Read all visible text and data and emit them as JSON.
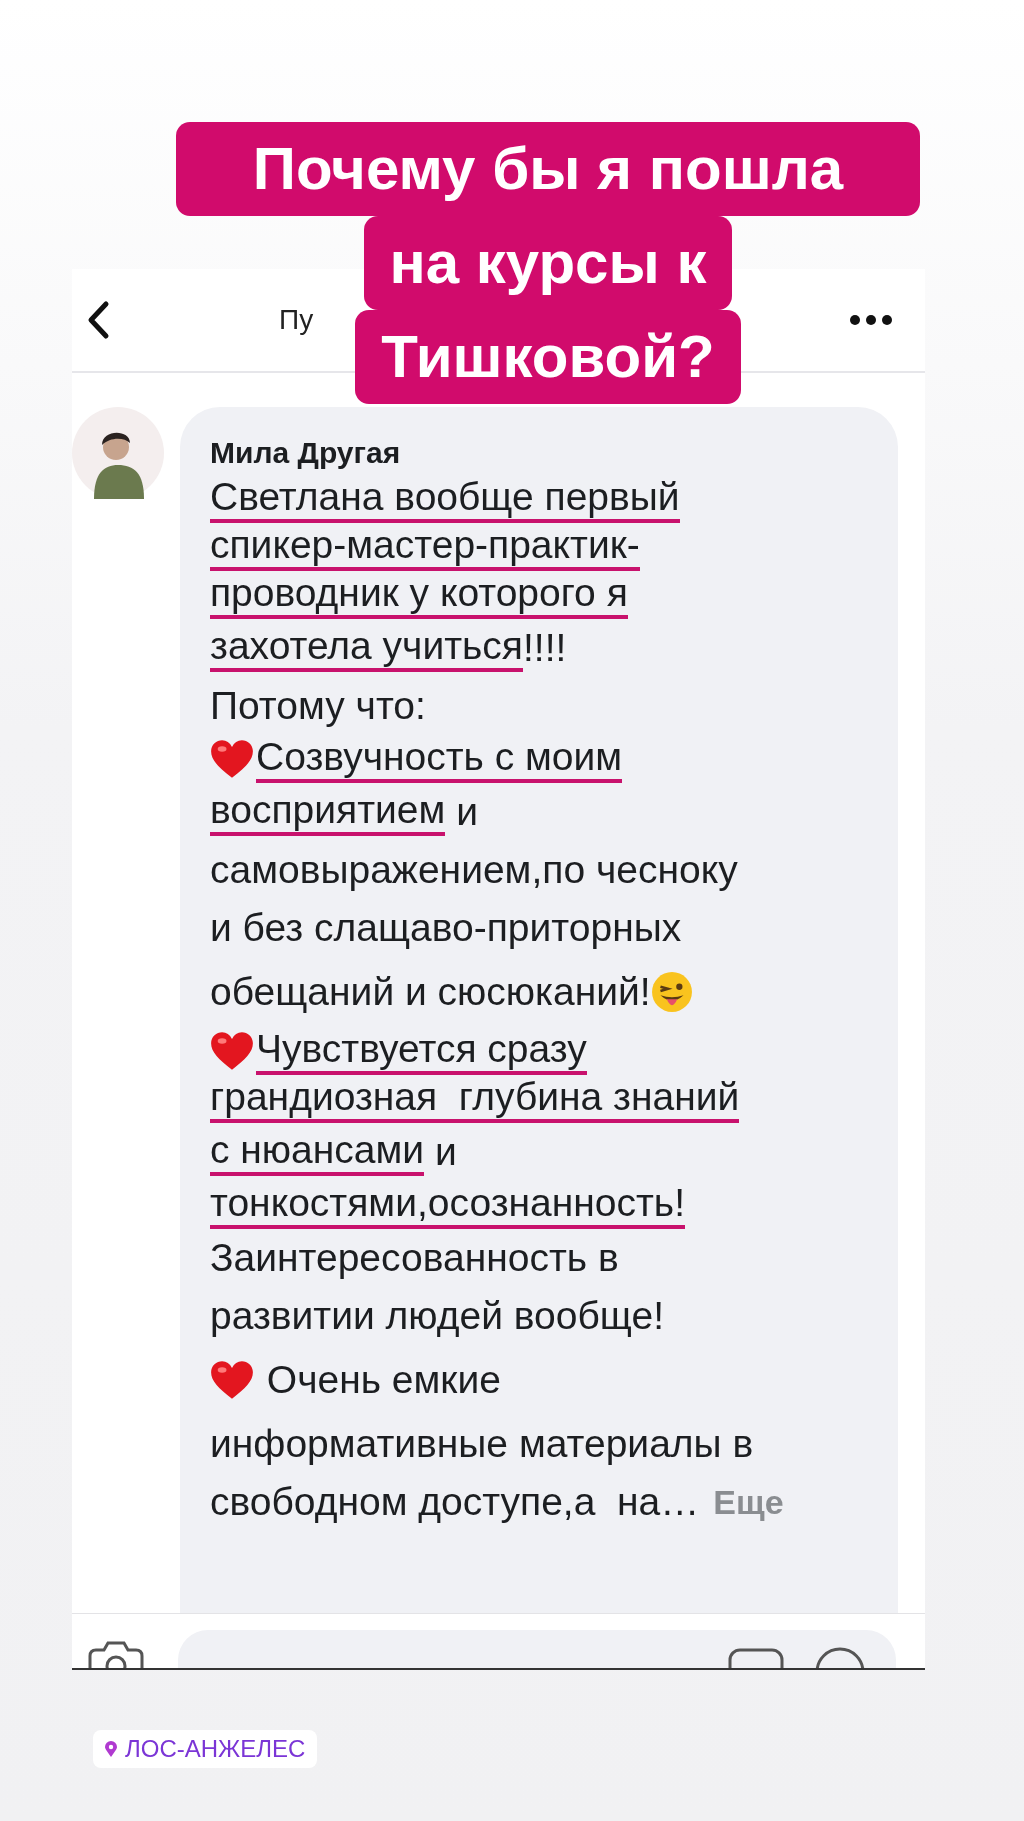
{
  "sticker": {
    "lines": [
      "Почему бы я пошла",
      "на курсы к",
      "Тишковой?"
    ]
  },
  "header": {
    "title": "Пу"
  },
  "comment": {
    "author": "Мила Другая",
    "more": "Еще",
    "lines": [
      {
        "parts": [
          {
            "kind": "text",
            "text": "Светлана вообще первый",
            "underlined": true
          }
        ]
      },
      {
        "parts": [
          {
            "kind": "text",
            "text": "спикер-мастер-практик-",
            "underlined": true
          }
        ]
      },
      {
        "parts": [
          {
            "kind": "text",
            "text": "проводник у которого я",
            "underlined": true
          }
        ]
      },
      {
        "parts": [
          {
            "kind": "text",
            "text": "захотела учиться",
            "underlined": true
          },
          {
            "kind": "text",
            "text": "!!!!",
            "underlined": false
          }
        ]
      },
      {
        "parts": [
          {
            "kind": "text",
            "text": "Потому что:",
            "underlined": false
          }
        ]
      },
      {
        "parts": [
          {
            "kind": "heart"
          },
          {
            "kind": "text",
            "text": "Созвучность с моим",
            "underlined": true
          }
        ]
      },
      {
        "parts": [
          {
            "kind": "text",
            "text": "восприятием",
            "underlined": true
          },
          {
            "kind": "text",
            "text": " и",
            "underlined": false
          }
        ]
      },
      {
        "parts": [
          {
            "kind": "text",
            "text": "самовыражением,по чесноку",
            "underlined": false
          }
        ]
      },
      {
        "parts": [
          {
            "kind": "text",
            "text": "и без слащаво-приторных",
            "underlined": false
          }
        ]
      },
      {
        "parts": [
          {
            "kind": "text",
            "text": "обещаний и сюсюканий!",
            "underlined": false
          },
          {
            "kind": "wink"
          }
        ]
      },
      {
        "parts": [
          {
            "kind": "heart"
          },
          {
            "kind": "text",
            "text": "Чувствуется сразу",
            "underlined": true
          }
        ]
      },
      {
        "parts": [
          {
            "kind": "text",
            "text": "грандиозная  глубина знаний",
            "underlined": true
          }
        ]
      },
      {
        "parts": [
          {
            "kind": "text",
            "text": "с нюансами",
            "underlined": true
          },
          {
            "kind": "text",
            "text": " и",
            "underlined": false
          }
        ]
      },
      {
        "parts": [
          {
            "kind": "text",
            "text": "тонкостями,осознанность!",
            "underlined": true
          }
        ]
      },
      {
        "parts": [
          {
            "kind": "text",
            "text": "Заинтересованность в",
            "underlined": false
          }
        ]
      },
      {
        "parts": [
          {
            "kind": "text",
            "text": "развитии людей вообще!",
            "underlined": false
          }
        ]
      },
      {
        "parts": [
          {
            "kind": "heart"
          },
          {
            "kind": "text",
            "text": " Очень емкие",
            "underlined": false
          }
        ]
      },
      {
        "parts": [
          {
            "kind": "text",
            "text": "информативные материалы в",
            "underlined": false
          }
        ]
      },
      {
        "parts": [
          {
            "kind": "text",
            "text": "свободном доступе,а  на…",
            "underlined": false
          }
        ]
      }
    ]
  },
  "location": {
    "label": "ЛОС-АНЖЕЛЕС"
  }
}
